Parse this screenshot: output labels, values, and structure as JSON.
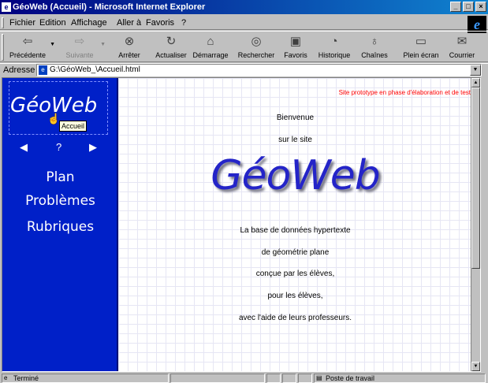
{
  "window": {
    "title": "GéoWeb (Accueil) - Microsoft Internet Explorer",
    "controls": [
      "_",
      "□",
      "×"
    ]
  },
  "menu": [
    "Fichier",
    "Edition",
    "Affichage",
    "Aller à",
    "Favoris",
    "?"
  ],
  "toolbar": [
    {
      "label": "Précédente",
      "icon": "back-arrow-icon",
      "glyph": "⇦",
      "enabled": true
    },
    {
      "label": "Suivante",
      "icon": "forward-arrow-icon",
      "glyph": "⇨",
      "enabled": false
    },
    {
      "label": "Arrêter",
      "icon": "stop-icon",
      "glyph": "⊗",
      "enabled": true
    },
    {
      "label": "Actualiser",
      "icon": "refresh-icon",
      "glyph": "↻",
      "enabled": true
    },
    {
      "label": "Démarrage",
      "icon": "home-icon",
      "glyph": "⌂",
      "enabled": true
    },
    {
      "label": "Rechercher",
      "icon": "search-icon",
      "glyph": "◎",
      "enabled": true
    },
    {
      "label": "Favoris",
      "icon": "favorites-icon",
      "glyph": "▣",
      "enabled": true
    },
    {
      "label": "Historique",
      "icon": "history-icon",
      "glyph": "◔",
      "enabled": true
    },
    {
      "label": "Chaînes",
      "icon": "channels-icon",
      "glyph": "♁",
      "enabled": true
    },
    {
      "label": "Plein écran",
      "icon": "fullscreen-icon",
      "glyph": "▭",
      "enabled": true
    },
    {
      "label": "Courrier",
      "icon": "mail-icon",
      "glyph": "✉",
      "enabled": true
    }
  ],
  "address": {
    "label": "Adresse",
    "url": "G:\\GéoWeb_\\Accueil.html"
  },
  "sidebar": {
    "logo": "GéoWeb",
    "tooltip": "Accueil",
    "nav": {
      "prev": "◀",
      "help": "?",
      "next": "▶"
    },
    "links": [
      "Plan",
      "Problèmes",
      "Rubriques"
    ]
  },
  "main": {
    "prototype_notice": "Site prototype en phase d'élaboration et de test",
    "welcome": "Bienvenue",
    "on_site": "sur le site",
    "logo": "GéoWeb",
    "description": [
      "La base de données hypertexte",
      "de géométrie plane",
      "conçue par les élèves,",
      "pour les élèves,",
      "avec l'aide de leurs professeurs."
    ]
  },
  "status": {
    "text": "Terminé",
    "zone": "Poste de travail"
  },
  "colors": {
    "sidebar": "#0020c8",
    "logo": "#2424c8",
    "notice": "#ff0000"
  }
}
